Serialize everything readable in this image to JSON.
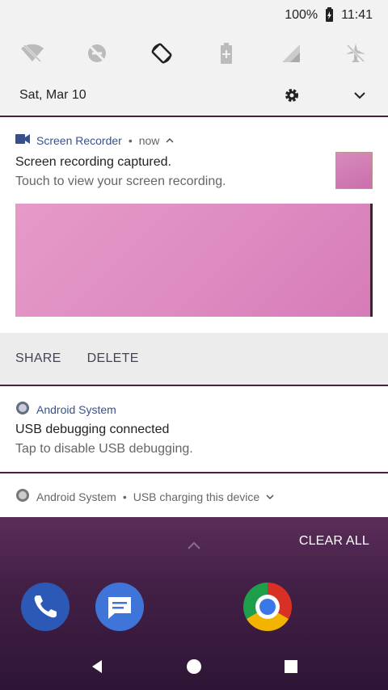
{
  "status_bar": {
    "battery": "100%",
    "time": "11:41"
  },
  "quick_settings": {
    "tiles": [
      "wifi-off-icon",
      "dnd-off-icon",
      "auto-rotate-icon",
      "battery-saver-icon",
      "cellular-signal-icon",
      "airplane-mode-icon"
    ],
    "date": "Sat, Mar 10"
  },
  "notifications": [
    {
      "app": "Screen Recorder",
      "time": "now",
      "title": "Screen recording captured.",
      "text": "Touch to view your screen recording.",
      "actions": [
        "SHARE",
        "DELETE"
      ]
    },
    {
      "app": "Android System",
      "title": "USB debugging connected",
      "text": "Tap to disable USB debugging."
    },
    {
      "app": "Android System",
      "summary": "USB charging this device"
    }
  ],
  "shade_footer": {
    "clear_all": "CLEAR ALL"
  },
  "colors": {
    "accent": "#38508a",
    "preview_pink": "#e69ac8",
    "shade_bg": "#f2f2f2"
  }
}
